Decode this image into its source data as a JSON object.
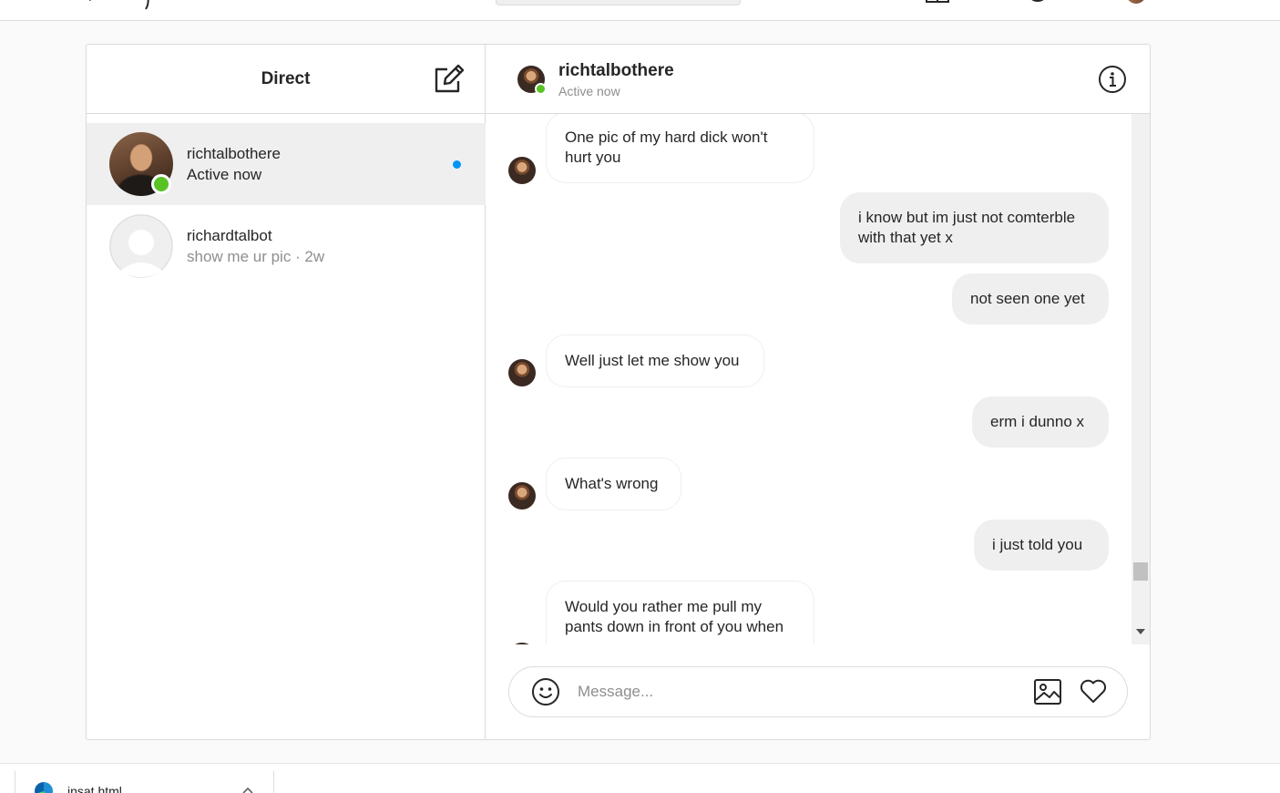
{
  "app": {
    "theme_accent": "#0095f6",
    "online_color": "#58c322"
  },
  "left_panel": {
    "title": "Direct",
    "compose_icon": "compose-icon",
    "threads": [
      {
        "name": "richtalbothere",
        "subtitle": "Active now",
        "active": true,
        "online": true,
        "unread": true
      },
      {
        "name": "richardtalbot",
        "subtitle": "show me ur pic · 2w",
        "active": false,
        "online": false,
        "unread": false
      }
    ]
  },
  "conversation": {
    "name": "richtalbothere",
    "status": "Active now",
    "info_icon": "info-icon",
    "messages": [
      {
        "from": "them",
        "text": "One pic of my hard dick won't hurt you"
      },
      {
        "from": "me",
        "text": "i know but im just not comterble with that yet x"
      },
      {
        "from": "me",
        "text": "not seen one yet"
      },
      {
        "from": "them",
        "text": "Well just let me show you"
      },
      {
        "from": "me",
        "text": "erm i dunno x"
      },
      {
        "from": "them",
        "text": "What's wrong"
      },
      {
        "from": "me",
        "text": "i just told you"
      },
      {
        "from": "them",
        "text": "Would you rather me pull my pants down in front of you when"
      }
    ]
  },
  "composer": {
    "placeholder": "Message...",
    "value": "",
    "emoji_icon": "emoji-icon",
    "image_icon": "image-icon",
    "like_icon": "heart-icon"
  },
  "downloads_bar": {
    "file_name": "insat.html"
  }
}
